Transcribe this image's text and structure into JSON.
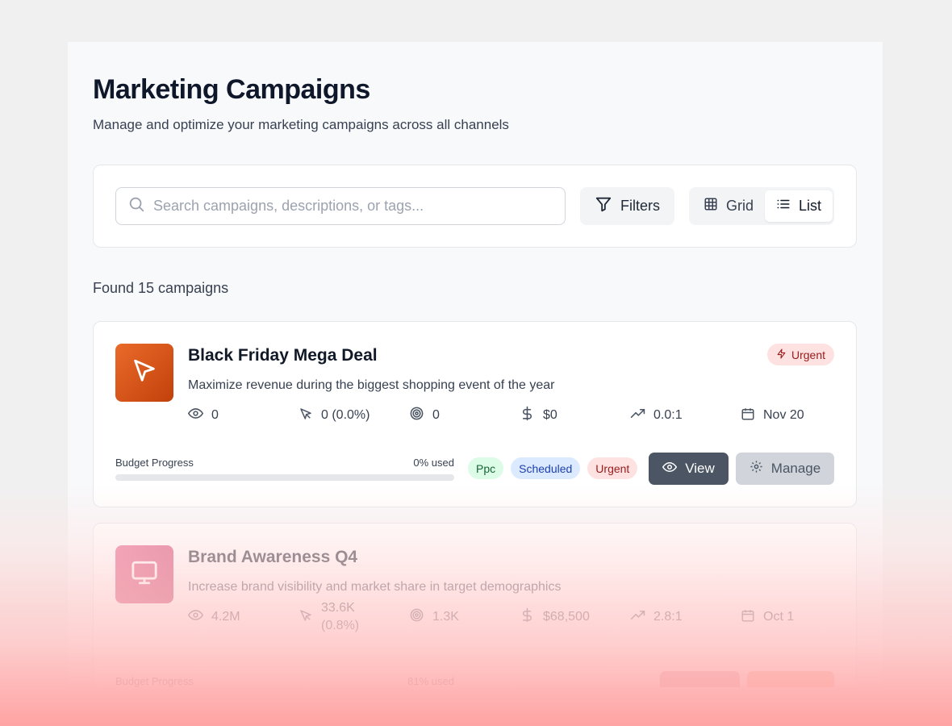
{
  "header": {
    "title": "Marketing Campaigns",
    "subtitle": "Manage and optimize your marketing campaigns across all channels"
  },
  "toolbar": {
    "search_placeholder": "Search campaigns, descriptions, or tags...",
    "filters_label": "Filters",
    "view_grid_label": "Grid",
    "view_list_label": "List",
    "active_view": "List"
  },
  "results": {
    "found_text": "Found 15 campaigns"
  },
  "campaigns": [
    {
      "title": "Black Friday Mega Deal",
      "description": "Maximize revenue during the biggest shopping event of the year",
      "icon": "cursor-pointer-icon",
      "priority_badge": "Urgent",
      "metrics": {
        "views": "0",
        "clicks": "0 (0.0%)",
        "conversions": "0",
        "revenue": "$0",
        "roi": "0.0:1",
        "date": "Nov 20"
      },
      "budget_label": "Budget Progress",
      "budget_used_text": "0% used",
      "budget_used_pct": 0,
      "tags": [
        "Ppc",
        "Scheduled",
        "Urgent"
      ],
      "view_label": "View",
      "manage_label": "Manage"
    },
    {
      "title": "Brand Awareness Q4",
      "description": "Increase brand visibility and market share in target demographics",
      "icon": "monitor-icon",
      "metrics": {
        "views": "4.2M",
        "clicks": "33.6K (0.8%)",
        "conversions": "1.3K",
        "revenue": "$68,500",
        "roi": "2.8:1",
        "date": "Oct 1"
      },
      "budget_label": "Budget Progress",
      "budget_used_text": "81% used",
      "budget_used_pct": 81
    }
  ],
  "colors": {
    "accent_dark": "#4b5563",
    "urgent_bg": "#fee2e2",
    "urgent_text": "#991b1b",
    "thumb_orange": "#ea6a2a",
    "thumb_pink": "#e5537f"
  }
}
